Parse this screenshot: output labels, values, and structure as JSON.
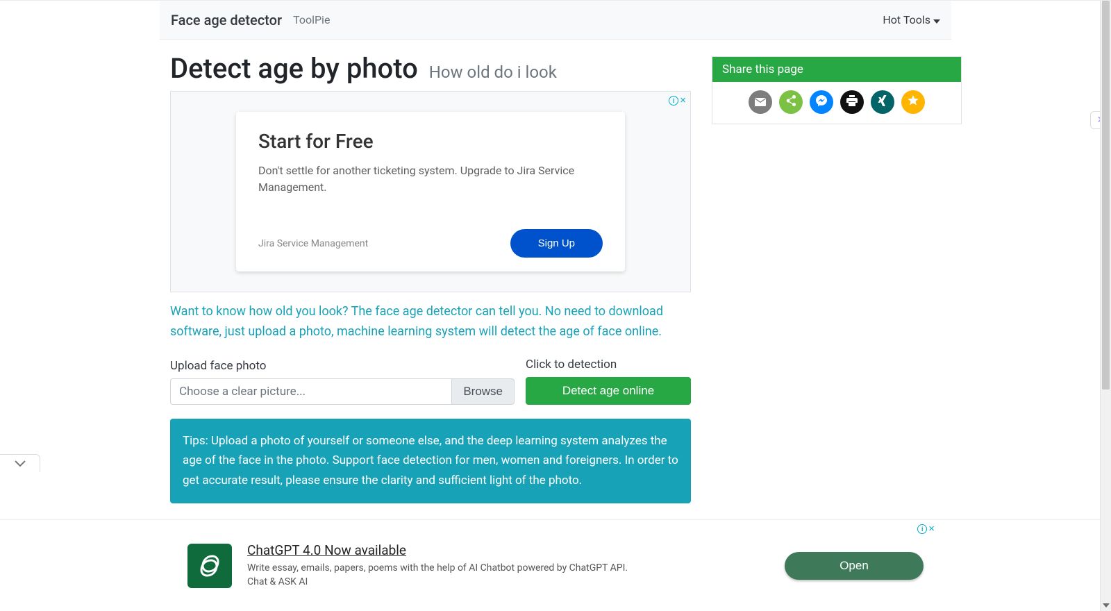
{
  "navbar": {
    "brand": "Face age detector",
    "brand_link": "ToolPie",
    "hot_tools": "Hot Tools"
  },
  "title": {
    "main": "Detect age by photo",
    "sub": "How old do i look"
  },
  "top_ad": {
    "title": "Start for Free",
    "desc": "Don't settle for another ticketing system. Upgrade to Jira Service Management.",
    "brand": "Jira Service Management",
    "cta": "Sign Up"
  },
  "intro": "Want to know how old you look? The face age detector can tell you. No need to download software, just upload a photo, machine learning system will detect the age of face online.",
  "form": {
    "upload_label": "Upload face photo",
    "placeholder": "Choose a clear picture...",
    "browse": "Browse",
    "detect_label": "Click to detection",
    "detect_button": "Detect age online"
  },
  "tips": "Tips: Upload a photo of yourself or someone else, and the deep learning system analyzes the age of the face in the photo. Support face detection for men, women and foreigners. In order to get accurate result, please ensure the clarity and sufficient light of the photo.",
  "share": {
    "title": "Share this page"
  },
  "bottom_ad": {
    "title": "ChatGPT 4.0 Now available",
    "desc": "Write essay, emails, papers, poems with the help of AI Chatbot powered by ChatGPT API. Chat & ASK AI",
    "cta": "Open"
  }
}
